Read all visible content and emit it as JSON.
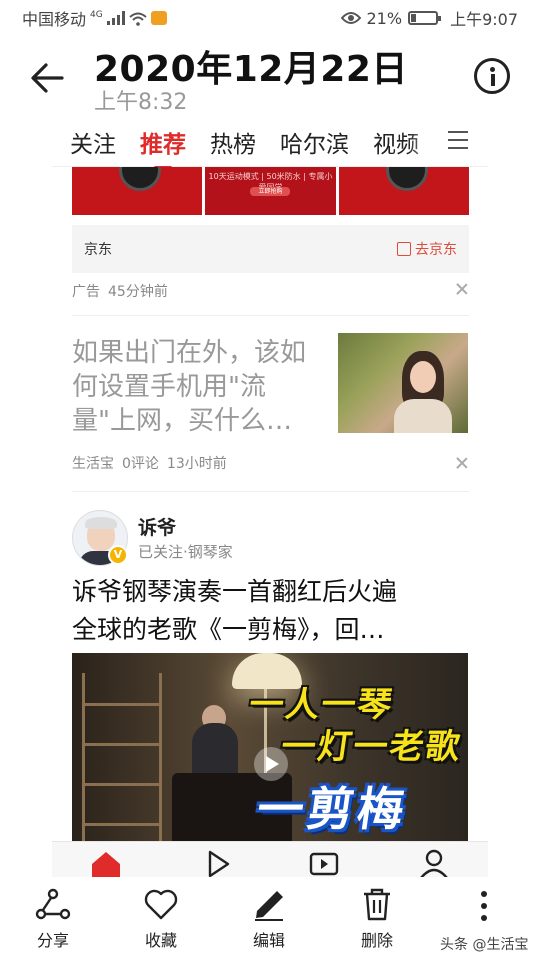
{
  "status_bar": {
    "carrier": "中国移动",
    "network_type": "4G",
    "battery_percent": "21%",
    "battery_level": 0.21,
    "time": "上午9:07"
  },
  "viewer": {
    "date_title": "2020年12月22日",
    "time_sub": "上午8:32"
  },
  "feed": {
    "tabs": [
      {
        "label": "关注"
      },
      {
        "label": "推荐",
        "active": true
      },
      {
        "label": "热榜"
      },
      {
        "label": "哈尔滨"
      },
      {
        "label": "视频"
      }
    ],
    "ad": {
      "banner_text": "10天运动模式 | 50米防水 | 专属小爱同学",
      "banner_button": "立即抢购",
      "brand": "京东",
      "link_label": "去京东",
      "tag": "广告",
      "time": "45分钟前"
    },
    "article1": {
      "title": "如果出门在外，该如何设置手机用\"流量\"上网，买什么…",
      "source": "生活宝",
      "comments": "0评论",
      "time": "13小时前"
    },
    "article2": {
      "author": "诉爷",
      "author_sub": "已关注·钢琴家",
      "verified_badge": "V",
      "title_line1": "诉爷钢琴演奏一首翻红后火遍",
      "title_line2": "全球的老歌《一剪梅》，回…",
      "video_text1": "一人一琴",
      "video_text2": "一灯一老歌",
      "video_text3": "一剪梅"
    }
  },
  "actions": {
    "share": "分享",
    "favorite": "收藏",
    "edit": "编辑",
    "delete": "删除"
  },
  "watermark": "头条 @生活宝",
  "colors": {
    "accent_red": "#e02b2b",
    "ad_red": "#c2161b",
    "badge_yellow": "#f5b400",
    "video_title_yellow": "#f8e31a",
    "video_title_blue": "#1a55c8"
  }
}
